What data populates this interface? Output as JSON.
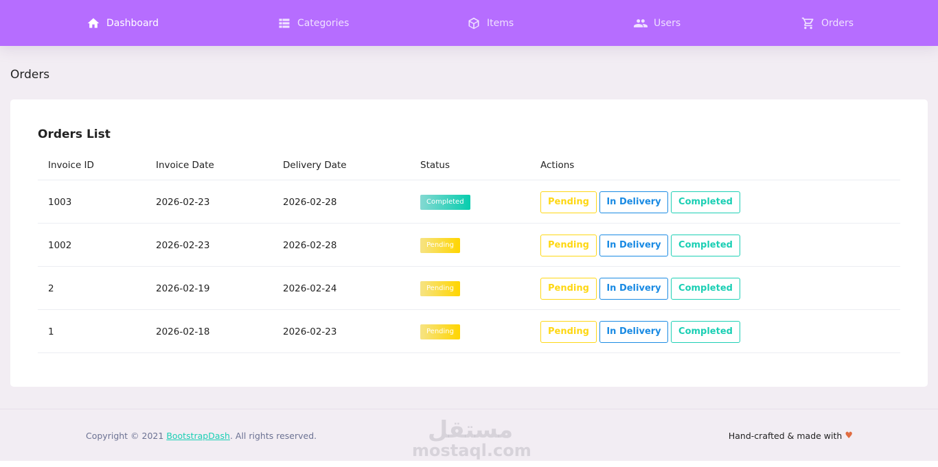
{
  "nav": {
    "items": [
      {
        "label": "Dashboard",
        "icon": "home-icon",
        "active": true
      },
      {
        "label": "Categories",
        "icon": "grid-icon"
      },
      {
        "label": "Items",
        "icon": "cube-icon"
      },
      {
        "label": "Users",
        "icon": "users-icon"
      },
      {
        "label": "Orders",
        "icon": "cart-icon"
      }
    ],
    "background": "#b66dff"
  },
  "page": {
    "title": "Orders"
  },
  "orders": {
    "title": "Orders List",
    "columns": [
      "Invoice ID",
      "Invoice Date",
      "Delivery Date",
      "Status",
      "Actions"
    ],
    "actions": {
      "pending": "Pending",
      "in_delivery": "In Delivery",
      "completed": "Completed"
    },
    "rows": [
      {
        "id": "1003",
        "invoice_date": "2026-02-23",
        "delivery_date": "2026-02-28",
        "status": "Completed"
      },
      {
        "id": "1002",
        "invoice_date": "2026-02-23",
        "delivery_date": "2026-02-28",
        "status": "Pending"
      },
      {
        "id": "2",
        "invoice_date": "2026-02-19",
        "delivery_date": "2026-02-24",
        "status": "Pending"
      },
      {
        "id": "1",
        "invoice_date": "2026-02-18",
        "delivery_date": "2026-02-23",
        "status": "Pending"
      }
    ]
  },
  "footer": {
    "copyright_prefix": "Copyright © 2021 ",
    "copyright_link": "BootstrapDash",
    "copyright_suffix": ". All rights reserved.",
    "handcrafted": "Hand-crafted & made with",
    "heart_icon": "heart-icon",
    "watermark_arabic": "مستقل",
    "watermark_latin": "mostaql.com"
  },
  "colors": {
    "completed": "#1bcfb4",
    "pending": "#fed713",
    "in_delivery": "#198ae3"
  }
}
